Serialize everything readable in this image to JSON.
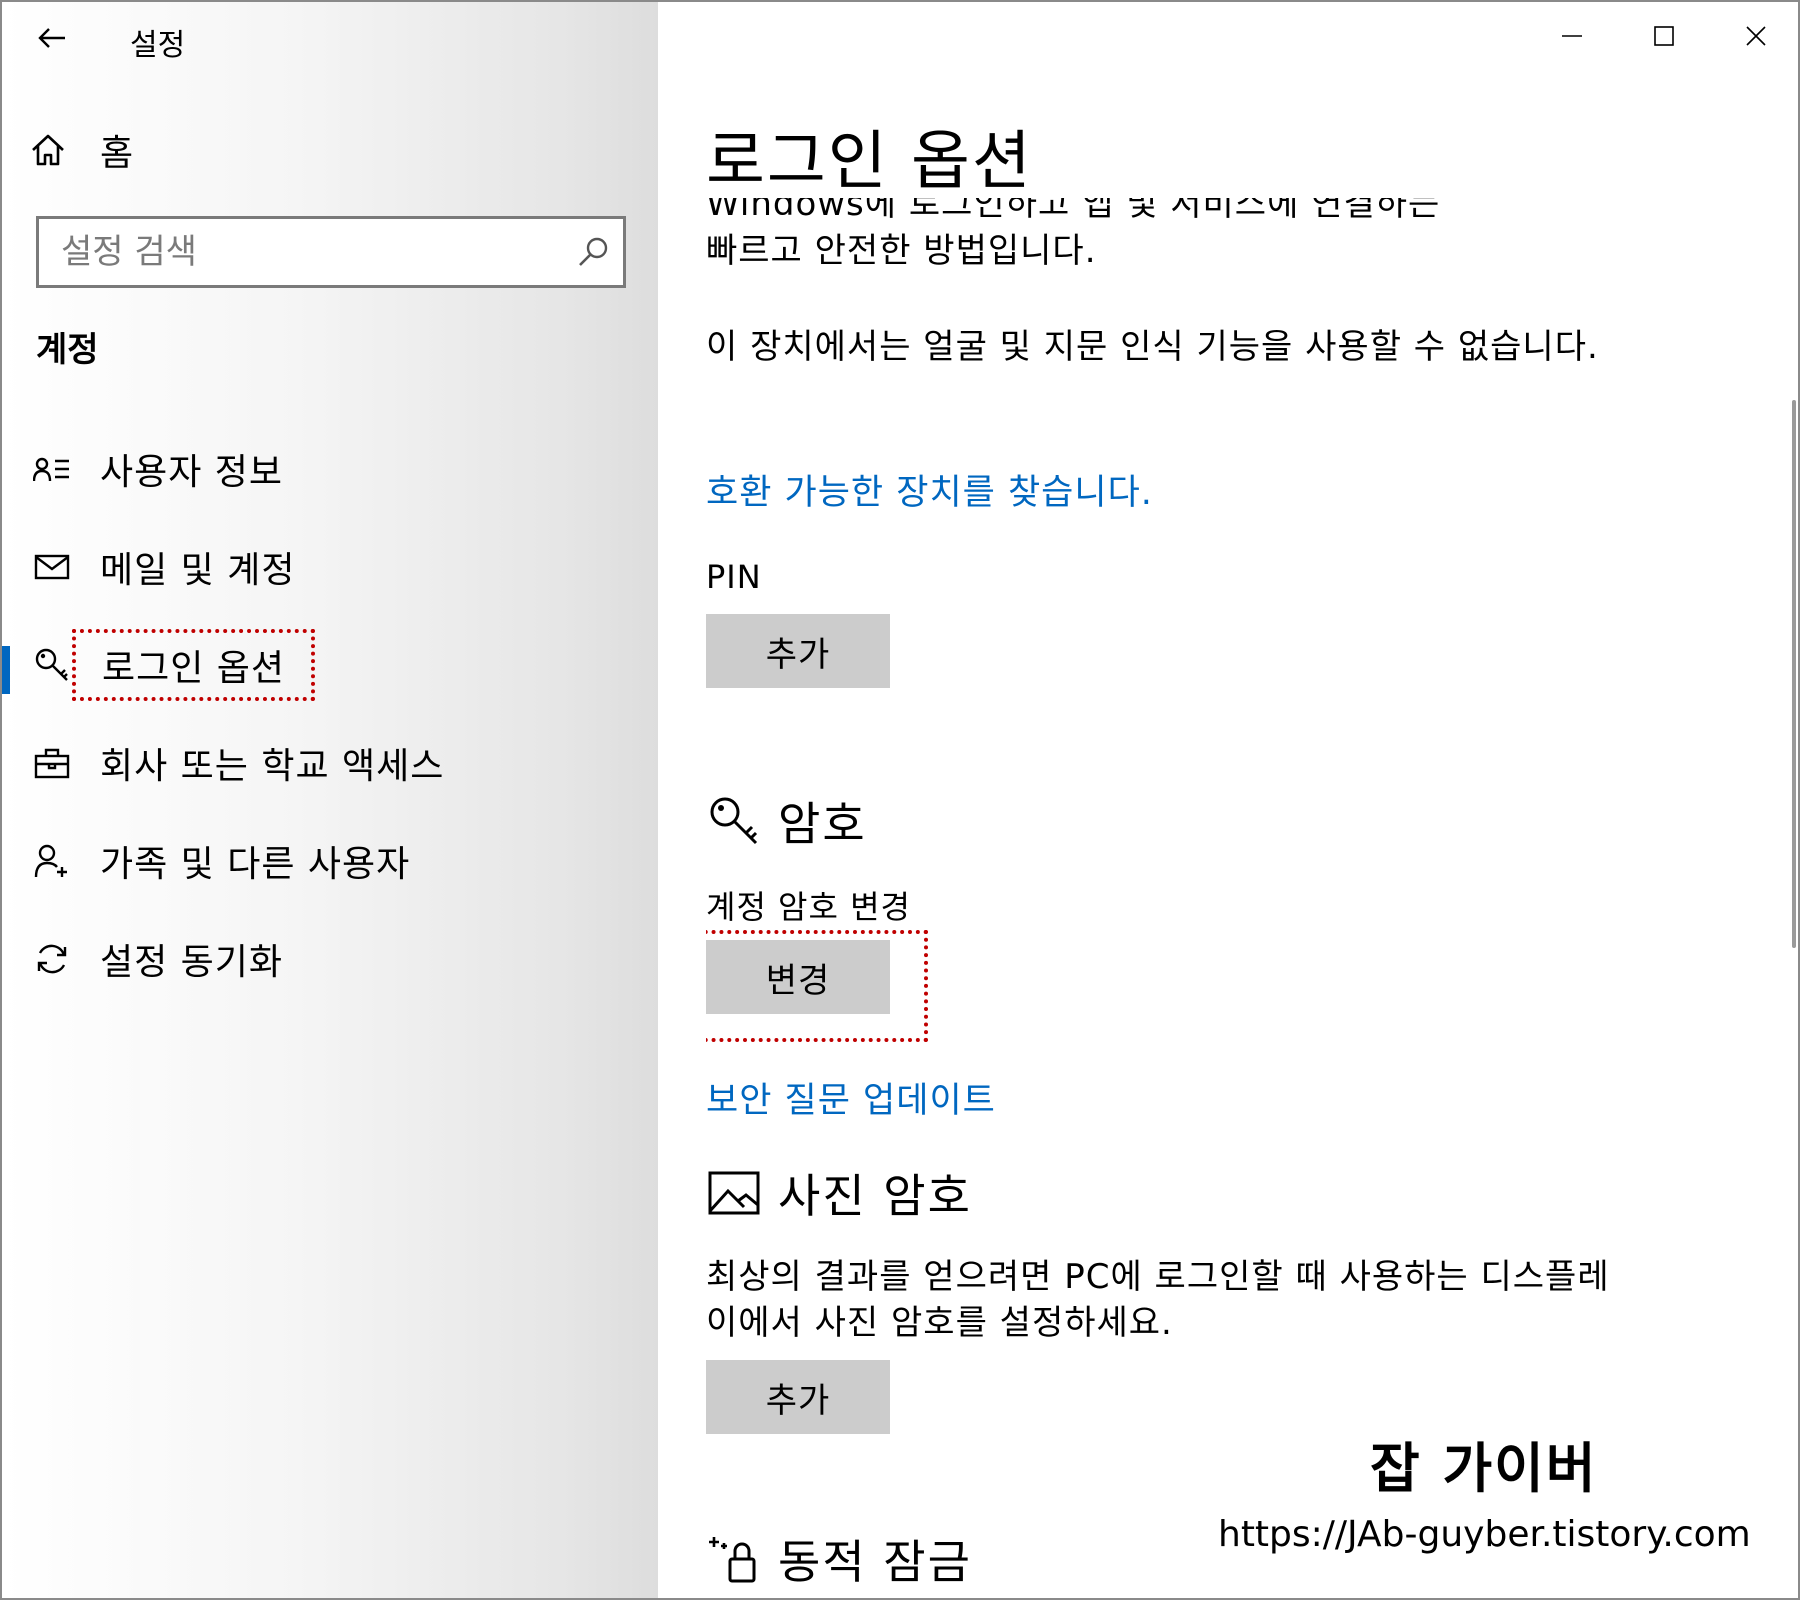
{
  "app": {
    "title": "설정"
  },
  "sidebar": {
    "home_label": "홈",
    "search_placeholder": "설정 검색",
    "section_title": "계정",
    "items": [
      {
        "label": "사용자 정보",
        "icon": "user-info-icon"
      },
      {
        "label": "메일 및 계정",
        "icon": "mail-icon"
      },
      {
        "label": "로그인 옵션",
        "icon": "key-icon",
        "active": true
      },
      {
        "label": "회사 또는 학교 액세스",
        "icon": "briefcase-icon"
      },
      {
        "label": "가족 및 다른 사용자",
        "icon": "person-add-icon"
      },
      {
        "label": "설정 동기화",
        "icon": "sync-icon"
      }
    ]
  },
  "content": {
    "page_title": "로그인 옵션",
    "cut_text": "Windows에 로그인하고 앱 및 서비스에 연결하는",
    "hello_desc_tail": "빠르고 안전한 방법입니다.",
    "face_fp_unavailable": "이 장치에서는 얼굴 및 지문 인식 기능을 사용할 수 없습니다.",
    "find_devices_link": "호환 가능한 장치를 찾습니다.",
    "pin_label": "PIN",
    "pin_add_button": "추가",
    "password_heading": "암호",
    "change_password_label": "계정 암호 변경",
    "change_button": "변경",
    "security_question_link": "보안 질문 업데이트",
    "picture_password_heading": "사진 암호",
    "picture_password_desc": "최상의 결과를 얻으려면 PC에 로그인할 때 사용하는 디스플레이에서 사진 암호를 설정하세요.",
    "picture_add_button": "추가",
    "dynamic_lock_heading": "동적 잠금"
  },
  "watermark": {
    "title": "잡 가이버",
    "url": "https://JAb-guyber.tistory.com"
  },
  "colors": {
    "accent": "#0067c0",
    "button_bg": "#cccccc",
    "highlight": "#c00000"
  }
}
